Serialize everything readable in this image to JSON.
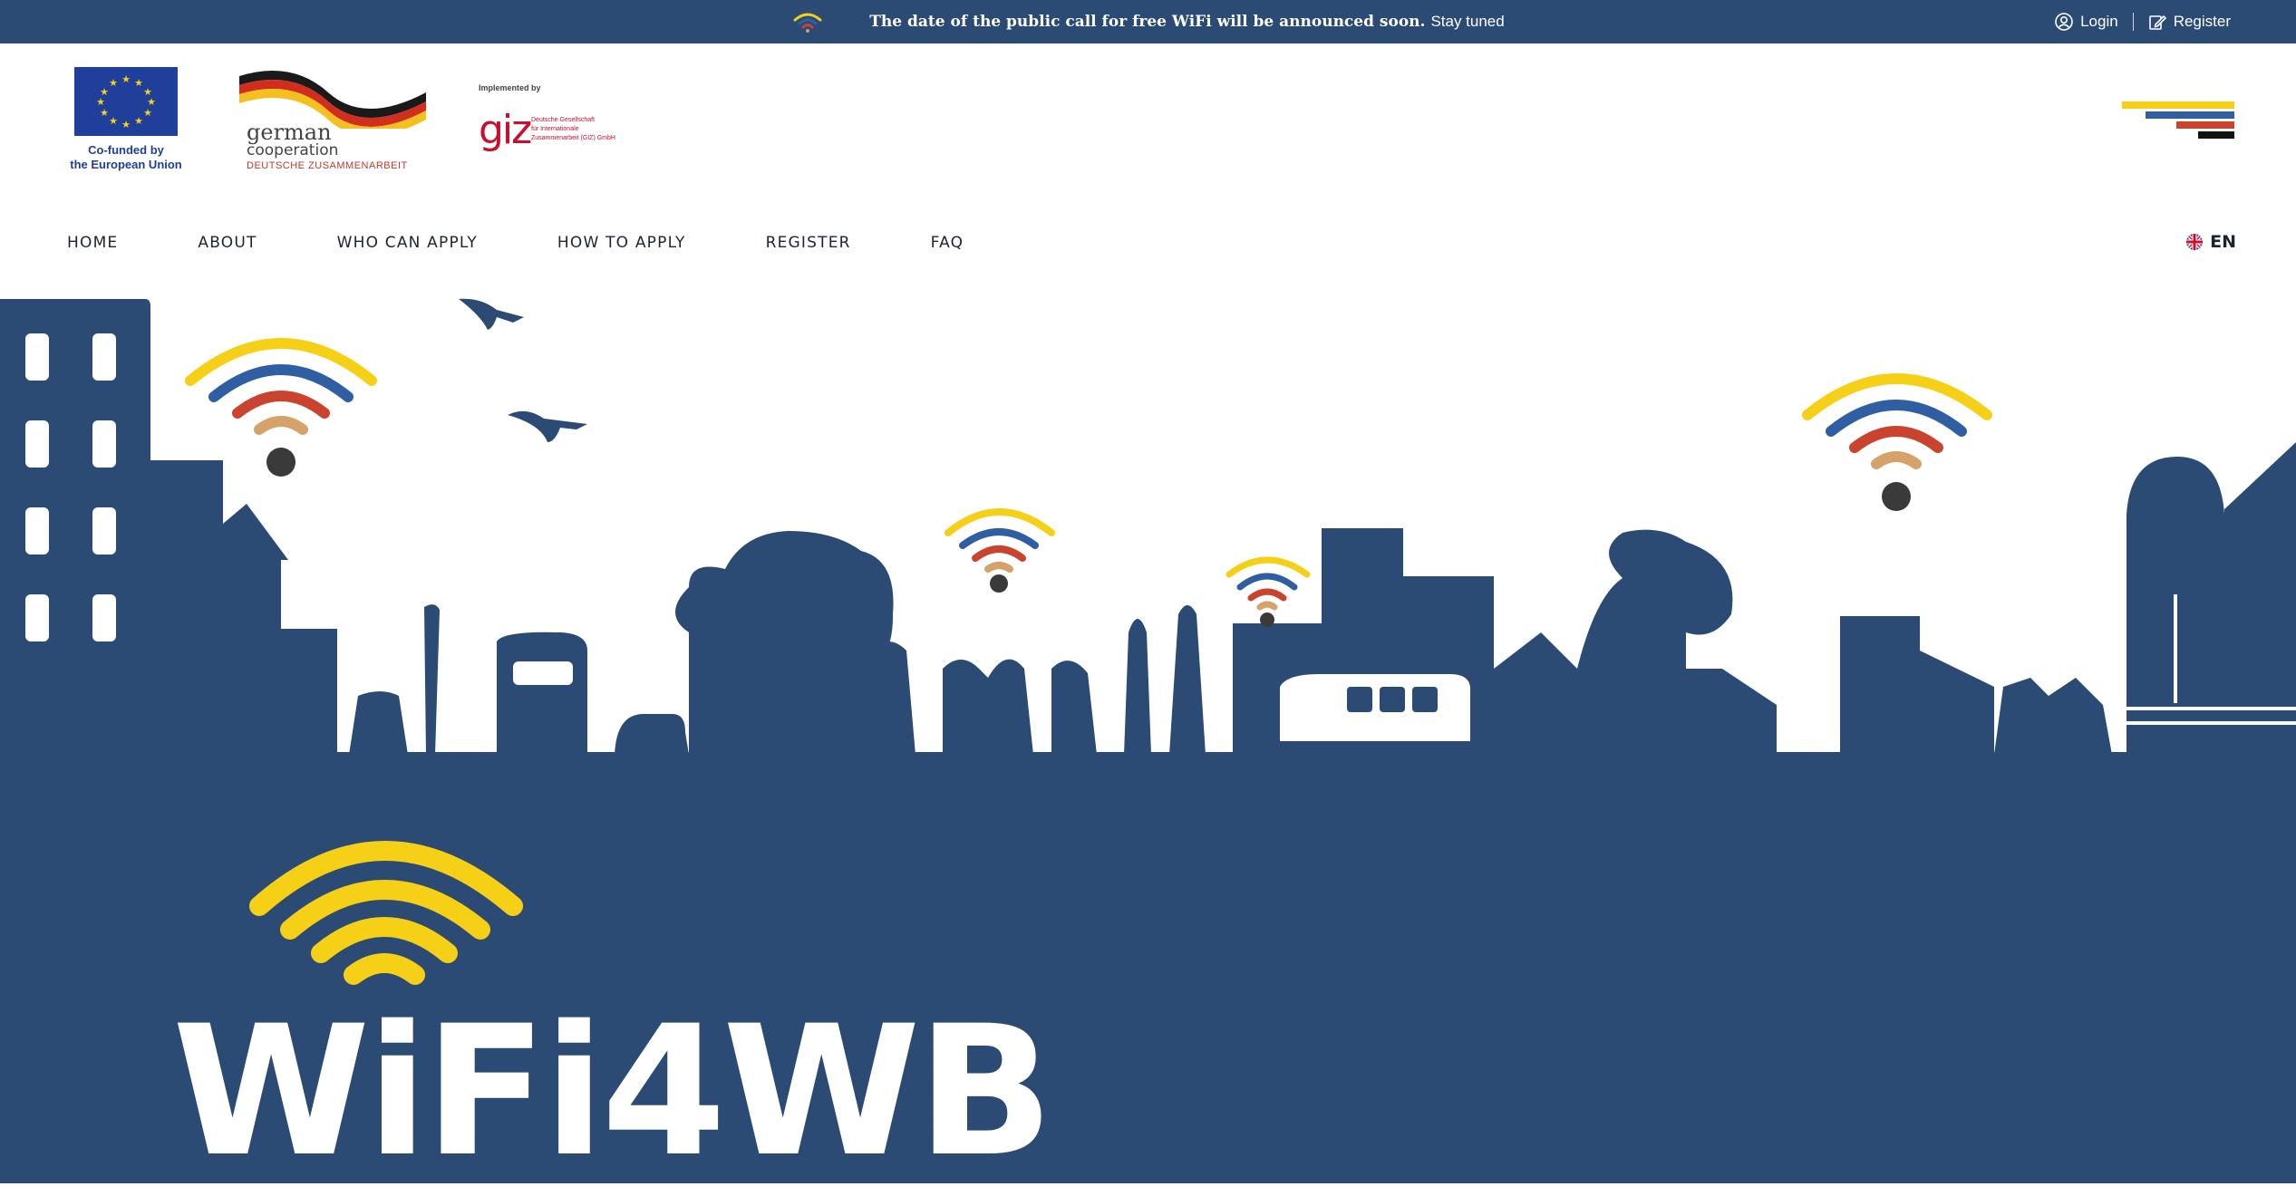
{
  "announcement": {
    "bold_text": "The date of the public call for free WiFi will be announced soon.",
    "rest_text": "Stay tuned"
  },
  "auth": {
    "login_label": "Login",
    "register_label": "Register"
  },
  "logos": {
    "eu_caption_line1": "Co-funded by",
    "eu_caption_line2": "the European Union",
    "gc_word1": "german",
    "gc_word2": "cooperation",
    "gc_word3": "DEUTSCHE ZUSAMMENARBEIT",
    "giz_implemented": "Implemented by",
    "giz_mark": "giz",
    "giz_line1": "Deutsche Gesellschaft",
    "giz_line2": "für Internationale",
    "giz_line3": "Zusammenarbeit (GIZ) GmbH"
  },
  "nav": {
    "items": [
      "HOME",
      "ABOUT",
      "WHO CAN APPLY",
      "HOW TO APPLY",
      "REGISTER",
      "FAQ"
    ],
    "language": "EN"
  },
  "hero": {
    "brand": "WiFi4WB"
  },
  "colors": {
    "navy": "#2b4a74",
    "yellow": "#f6cf17",
    "blue": "#2f5ea3",
    "red": "#c9432f",
    "tan": "#d5a26a",
    "dark": "#3a3a3a"
  },
  "icons": {
    "login": "user-circle-icon",
    "register": "edit-icon",
    "language_flag": "uk-flag-icon",
    "menu": "menu-icon"
  }
}
